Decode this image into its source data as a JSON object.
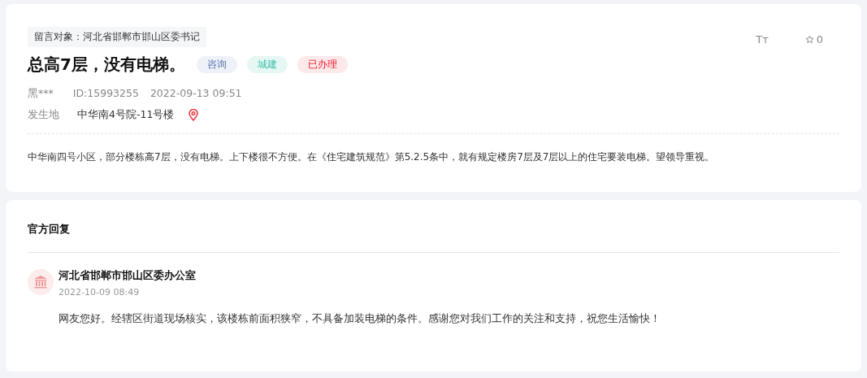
{
  "post": {
    "recipient": "留言对象：河北省邯郸市邯山区委书记",
    "title": "总高7层，没有电梯。",
    "tags": [
      {
        "label": "咨询",
        "color": "#eef1f7"
      },
      {
        "label": "城建",
        "color": "#e6f7f4"
      },
      {
        "label": "已办理",
        "color": "#fde8ea"
      }
    ],
    "font_button": "Tт",
    "likes": "0",
    "author": "黑***",
    "id": "ID:15993255",
    "time": "2022-09-13 09:51",
    "location_label": "发生地",
    "location": "中华南4号院-11号楼",
    "body": "中华南四号小区，部分楼栋高7层，没有电梯。上下楼很不方便。在《住宅建筑规范》第5.2.5条中，就有规定楼房7层及7层以上的住宅要装电梯。望领导重视。"
  },
  "reply": {
    "heading": "官方回复",
    "org": "河北省邯郸市邯山区委办公室",
    "time": "2022-10-09 08:49",
    "text": "网友您好。经辖区街道现场核实，该楼栋前面积狭窄，不具备加装电梯的条件。感谢您对我们工作的关注和支持，祝您生活愉快！"
  }
}
